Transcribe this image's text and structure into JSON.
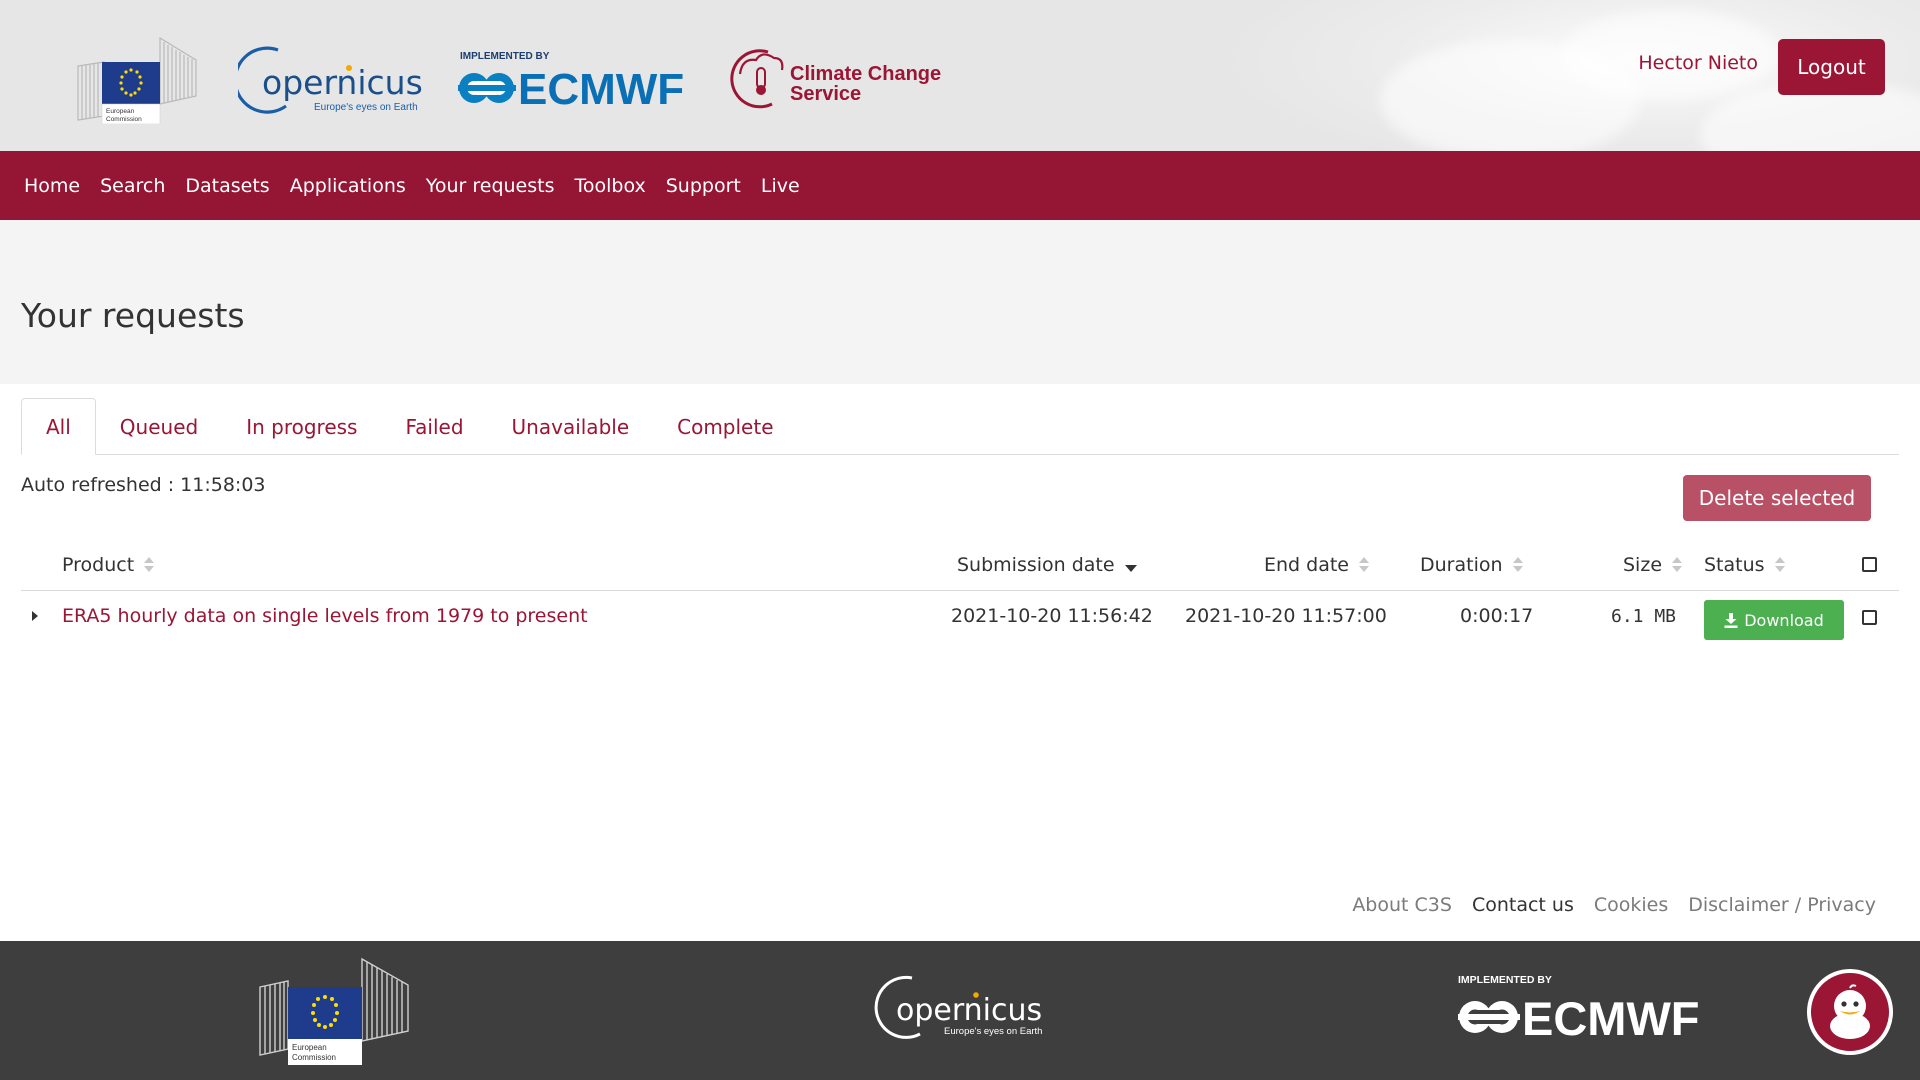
{
  "header": {
    "logos": {
      "ec_text_line1": "European",
      "ec_text_line2": "Commission",
      "copernicus_name": "opernicus",
      "copernicus_tagline": "Europe's eyes on Earth",
      "ecmwf_implemented": "IMPLEMENTED BY",
      "ecmwf_name": "ECMWF",
      "c3s_line1": "Climate Change",
      "c3s_line2": "Service"
    },
    "user_name": "Hector Nieto",
    "logout_label": "Logout"
  },
  "nav": {
    "items": [
      "Home",
      "Search",
      "Datasets",
      "Applications",
      "Your requests",
      "Toolbox",
      "Support",
      "Live"
    ]
  },
  "page": {
    "title": "Your requests",
    "tabs": [
      "All",
      "Queued",
      "In progress",
      "Failed",
      "Unavailable",
      "Complete"
    ],
    "active_tab": "All",
    "auto_refreshed": "Auto refreshed : 11:58:03",
    "delete_label": "Delete selected"
  },
  "table": {
    "headers": {
      "product": "Product",
      "submission_date": "Submission date",
      "end_date": "End date",
      "duration": "Duration",
      "size": "Size",
      "status": "Status"
    },
    "rows": [
      {
        "product": "ERA5 hourly data on single levels from 1979 to present",
        "submission_date": "2021-10-20 11:56:42",
        "end_date": "2021-10-20 11:57:00",
        "duration": "0:00:17",
        "size": "6.1 MB",
        "status_button": "Download"
      }
    ]
  },
  "footer": {
    "links": [
      "About C3S",
      "Contact us",
      "Cookies",
      "Disclaimer / Privacy"
    ]
  },
  "colors": {
    "brand": "#951535",
    "download": "#4caf50",
    "delete": "#b85066",
    "footer_bg": "#3e3e3e"
  },
  "icons": [
    "sort-icon",
    "sort-down-icon",
    "expand-arrow-icon",
    "download-icon",
    "checkbox-icon",
    "chat-mascot-icon"
  ]
}
